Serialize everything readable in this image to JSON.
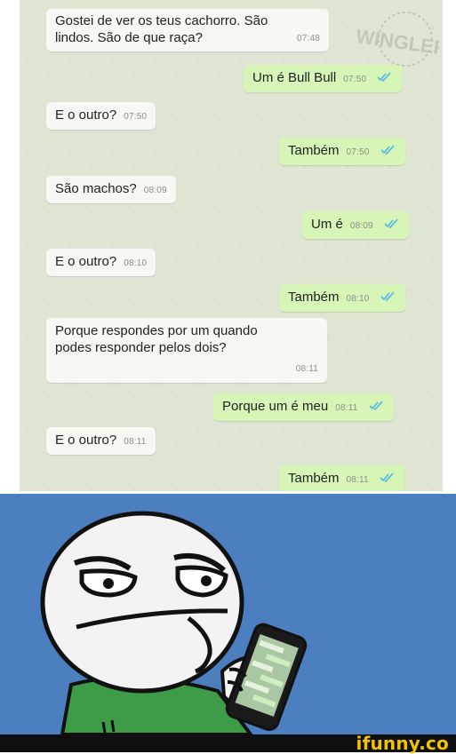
{
  "chat": {
    "watermark_text": "WINGLER",
    "messages": [
      {
        "from": "in",
        "text": "Gostei de ver os teus cachorro. São lindos. São de que raça?",
        "time": "07:48"
      },
      {
        "from": "out",
        "text": "Um é Bull Bull",
        "time": "07:50",
        "read": true
      },
      {
        "from": "in",
        "text": "E o outro?",
        "time": "07:50"
      },
      {
        "from": "out",
        "text": "Também",
        "time": "07:50",
        "read": true
      },
      {
        "from": "in",
        "text": "São machos?",
        "time": "08:09"
      },
      {
        "from": "out",
        "text": "Um é",
        "time": "08:09",
        "read": true
      },
      {
        "from": "in",
        "text": "E o outro?",
        "time": "08:10"
      },
      {
        "from": "out",
        "text": "Também",
        "time": "08:10",
        "read": true
      },
      {
        "from": "in",
        "text": "Porque respondes por um quando podes responder pelos dois?",
        "time": "08:11"
      },
      {
        "from": "out",
        "text": "Porque um é meu",
        "time": "08:11",
        "read": true
      },
      {
        "from": "in",
        "text": "E o outro?",
        "time": "08:11"
      },
      {
        "from": "out",
        "text": "Também",
        "time": "08:11",
        "read": true
      }
    ]
  },
  "meme": {
    "background_color": "#4b7fbf",
    "description_icon": "skeptical-face-with-phone-icon"
  },
  "footer": {
    "brand": "ifunny.co"
  },
  "colors": {
    "incoming_bubble": "#f7f8f3",
    "outgoing_bubble": "#d6f5b6",
    "read_ticks": "#4fb6e8",
    "brand": "#f2c200"
  }
}
